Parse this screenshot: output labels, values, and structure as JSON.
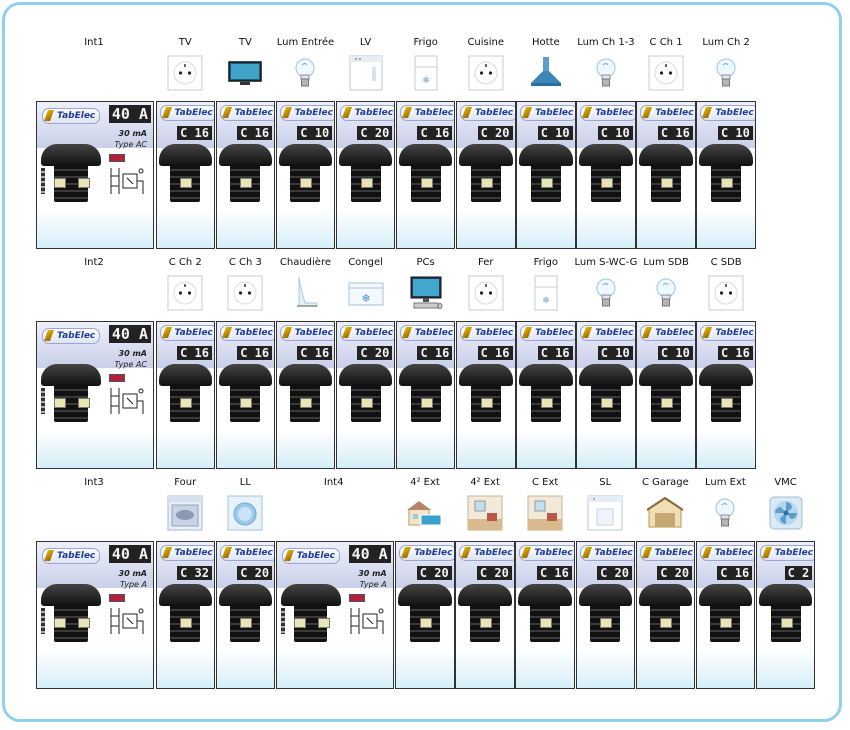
{
  "brand": "TabElec",
  "rows": [
    {
      "rcd": {
        "name": "Int1",
        "rating": "40 A",
        "sensitivity": "30 mA",
        "type": "Type  AC"
      },
      "circuits": [
        {
          "label": "TV",
          "breaker": "C 16",
          "icon": "socket-icon"
        },
        {
          "label": "TV",
          "breaker": "C 16",
          "icon": "tv-icon"
        },
        {
          "label": "Lum Entrée",
          "breaker": "C 10",
          "icon": "bulb-icon"
        },
        {
          "label": "LV",
          "breaker": "C 20",
          "icon": "dishwasher-icon"
        },
        {
          "label": "Frigo",
          "breaker": "C 16",
          "icon": "fridge-icon"
        },
        {
          "label": "Cuisine",
          "breaker": "C 20",
          "icon": "socket-icon"
        },
        {
          "label": "Hotte",
          "breaker": "C 10",
          "icon": "hood-icon"
        },
        {
          "label": "Lum Ch 1-3",
          "breaker": "C 10",
          "icon": "bulb-icon"
        },
        {
          "label": "C Ch 1",
          "breaker": "C 16",
          "icon": "socket-icon"
        },
        {
          "label": "Lum Ch 2",
          "breaker": "C 10",
          "icon": "bulb-icon"
        }
      ]
    },
    {
      "rcd": {
        "name": "Int2",
        "rating": "40 A",
        "sensitivity": "30 mA",
        "type": "Type  AC"
      },
      "circuits": [
        {
          "label": "C Ch 2",
          "breaker": "C 16",
          "icon": "socket-icon"
        },
        {
          "label": "C Ch 3",
          "breaker": "C 16",
          "icon": "socket-icon"
        },
        {
          "label": "Chaudière",
          "breaker": "C 16",
          "icon": "boiler-icon"
        },
        {
          "label": "Congel",
          "breaker": "C 20",
          "icon": "freezer-icon"
        },
        {
          "label": "PCs",
          "breaker": "C 16",
          "icon": "computer-icon"
        },
        {
          "label": "Fer",
          "breaker": "C 16",
          "icon": "socket-icon"
        },
        {
          "label": "Frigo",
          "breaker": "C 16",
          "icon": "fridge-icon"
        },
        {
          "label": "Lum S-WC-G",
          "breaker": "C 10",
          "icon": "bulb-icon"
        },
        {
          "label": "Lum SDB",
          "breaker": "C 10",
          "icon": "bulb-icon"
        },
        {
          "label": "C SDB",
          "breaker": "C 16",
          "icon": "socket-icon"
        }
      ]
    },
    {
      "rcd": {
        "name": "Int3",
        "rating": "40 A",
        "sensitivity": "30 mA",
        "type": "Type  A"
      },
      "circuits": [
        {
          "label": "Four",
          "breaker": "C 32",
          "icon": "oven-icon"
        },
        {
          "label": "LL",
          "breaker": "C 20",
          "icon": "washer-icon"
        }
      ],
      "rcd2": {
        "name": "Int4",
        "rating": "40 A",
        "sensitivity": "30 mA",
        "type": "Type  A"
      },
      "circuits2": [
        {
          "label": "4² Ext",
          "breaker": "C 20",
          "icon": "house-ext-icon"
        },
        {
          "label": "4² Ext",
          "breaker": "C 20",
          "icon": "room-icon"
        },
        {
          "label": "C Ext",
          "breaker": "C 16",
          "icon": "room-icon"
        },
        {
          "label": "SL",
          "breaker": "C 20",
          "icon": "dryer-icon"
        },
        {
          "label": "C Garage",
          "breaker": "C 20",
          "icon": "garage-icon"
        },
        {
          "label": "Lum Ext",
          "breaker": "C 16",
          "icon": "bulb-icon"
        },
        {
          "label": "VMC",
          "breaker": "C 2",
          "icon": "fan-icon"
        }
      ]
    }
  ]
}
